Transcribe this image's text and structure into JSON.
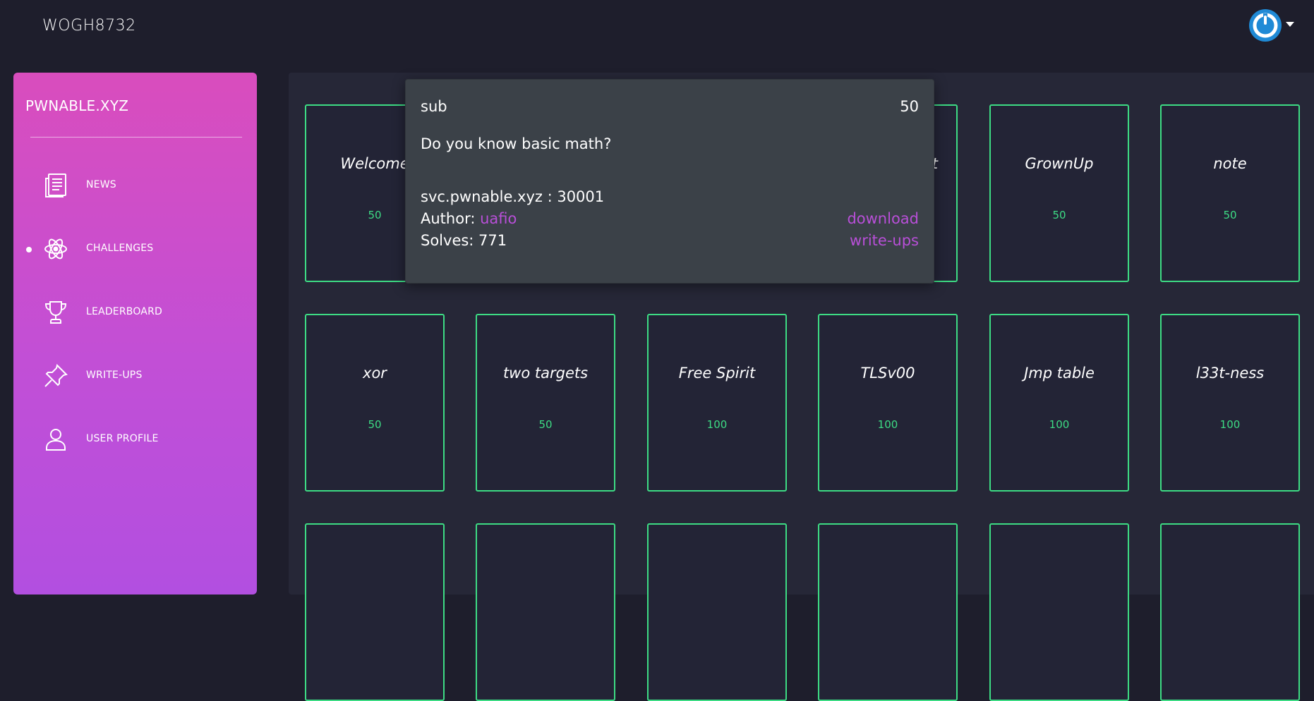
{
  "header": {
    "username": "WOGH8732",
    "power_icon": "power-icon"
  },
  "sidebar": {
    "brand": "PWNABLE.XYZ",
    "items": [
      {
        "label": "NEWS",
        "icon": "news-icon",
        "active": false
      },
      {
        "label": "CHALLENGES",
        "icon": "atom-icon",
        "active": true
      },
      {
        "label": "LEADERBOARD",
        "icon": "trophy-icon",
        "active": false
      },
      {
        "label": "WRITE-UPS",
        "icon": "pin-icon",
        "active": false
      },
      {
        "label": "USER PROFILE",
        "icon": "user-icon",
        "active": false
      }
    ]
  },
  "challenges": {
    "rows": [
      [
        {
          "name": "Welcome",
          "points": "50"
        },
        {
          "name": "",
          "points": ""
        },
        {
          "name": "",
          "points": ""
        },
        {
          "name": "t",
          "points": ""
        },
        {
          "name": "GrownUp",
          "points": "50"
        },
        {
          "name": "note",
          "points": "50"
        }
      ],
      [
        {
          "name": "xor",
          "points": "50"
        },
        {
          "name": "two targets",
          "points": "50"
        },
        {
          "name": "Free Spirit",
          "points": "100"
        },
        {
          "name": "TLSv00",
          "points": "100"
        },
        {
          "name": "Jmp table",
          "points": "100"
        },
        {
          "name": "l33t-ness",
          "points": "100"
        }
      ],
      [
        {
          "name": "",
          "points": ""
        },
        {
          "name": "",
          "points": ""
        },
        {
          "name": "",
          "points": ""
        },
        {
          "name": "",
          "points": ""
        },
        {
          "name": "",
          "points": ""
        },
        {
          "name": "",
          "points": ""
        }
      ]
    ]
  },
  "popover": {
    "title": "sub",
    "score": "50",
    "description": "Do you know basic math?",
    "service": "svc.pwnable.xyz : 30001",
    "author_label": "Author: ",
    "author": "uafio",
    "solves": "Solves: 771",
    "download": "download",
    "writeups": "write-ups"
  },
  "colors": {
    "accent_green": "#3ddc84",
    "link_purple": "#b84fd8",
    "power_blue": "#1f8ad6"
  }
}
